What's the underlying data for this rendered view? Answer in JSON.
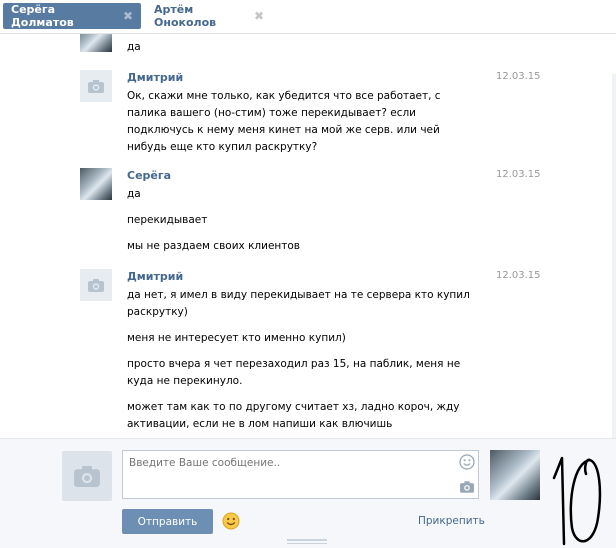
{
  "tabs": [
    {
      "label": "Серёга Долматов",
      "active": true
    },
    {
      "label": "Артём Оноколов",
      "active": false
    }
  ],
  "messages": [
    {
      "author": "",
      "date": "",
      "lines": [
        "да"
      ]
    },
    {
      "author": "Дмитрий",
      "date": "12.03.15",
      "lines": [
        "Ок, скажи мне только, как убедится что все работает, с палика вашего (но-стим) тоже перекидывает? если подключусь к нему меня кинет на мой же серв. или чей нибудь еще кто купил раскрутку?"
      ]
    },
    {
      "author": "Серёга",
      "date": "12.03.15",
      "lines": [
        "да",
        "перекидывает",
        "мы не раздаем своих клиентов"
      ]
    },
    {
      "author": "Дмитрий",
      "date": "12.03.15",
      "lines": [
        "да нет, я имел в виду перекидывает на те сервера кто купил раскрутку)",
        "меня не интересует кто именно купил)",
        "просто вчера я чет перезаходил раз 15, на паблик, меня не куда не перекинуло.",
        "может там как то по другому считает хз, ладно короч, жду активации, если не в лом напиши как влючишь"
      ]
    }
  ],
  "composer": {
    "placeholder": "Введите Ваше сообщение..",
    "send_label": "Отправить",
    "attach_label": "Прикрепить"
  },
  "icons": {
    "tab_close": "close-icon",
    "camera": "camera-icon",
    "smile": "smile-icon"
  },
  "colors": {
    "accent": "#587ba2",
    "link": "#45688e",
    "button": "#6d8fb3"
  },
  "overlay": {
    "scrawl": "10"
  }
}
